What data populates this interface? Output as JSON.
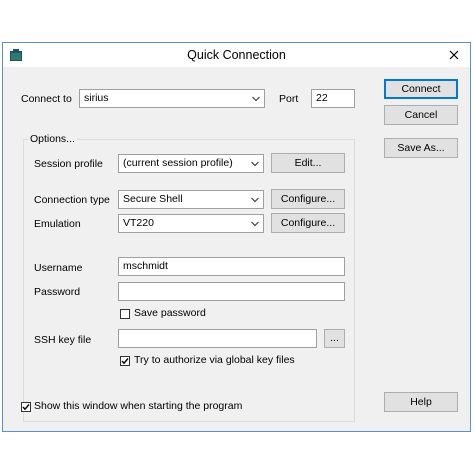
{
  "window": {
    "title": "Quick Connection"
  },
  "connection": {
    "connect_to_label": "Connect to",
    "connect_to_value": "sirius",
    "port_label": "Port",
    "port_value": "22"
  },
  "buttons": {
    "connect": "Connect",
    "cancel": "Cancel",
    "save_as": "Save As...",
    "help": "Help"
  },
  "options": {
    "legend": "Options...",
    "session_profile_label": "Session profile",
    "session_profile_value": "(current session profile)",
    "edit_button": "Edit...",
    "connection_type_label": "Connection type",
    "connection_type_value": "Secure Shell",
    "configure_button_1": "Configure...",
    "emulation_label": "Emulation",
    "emulation_value": "VT220",
    "configure_button_2": "Configure...",
    "username_label": "Username",
    "username_value": "mschmidt",
    "password_label": "Password",
    "password_value": "",
    "save_password_label": "Save password",
    "save_password_checked": false,
    "ssh_key_label": "SSH key file",
    "ssh_key_value": "",
    "browse_button": "...",
    "global_keys_label": "Try to authorize via global key files",
    "global_keys_checked": true
  },
  "footer": {
    "show_window_label": "Show this window when starting the program",
    "show_window_checked": true
  }
}
